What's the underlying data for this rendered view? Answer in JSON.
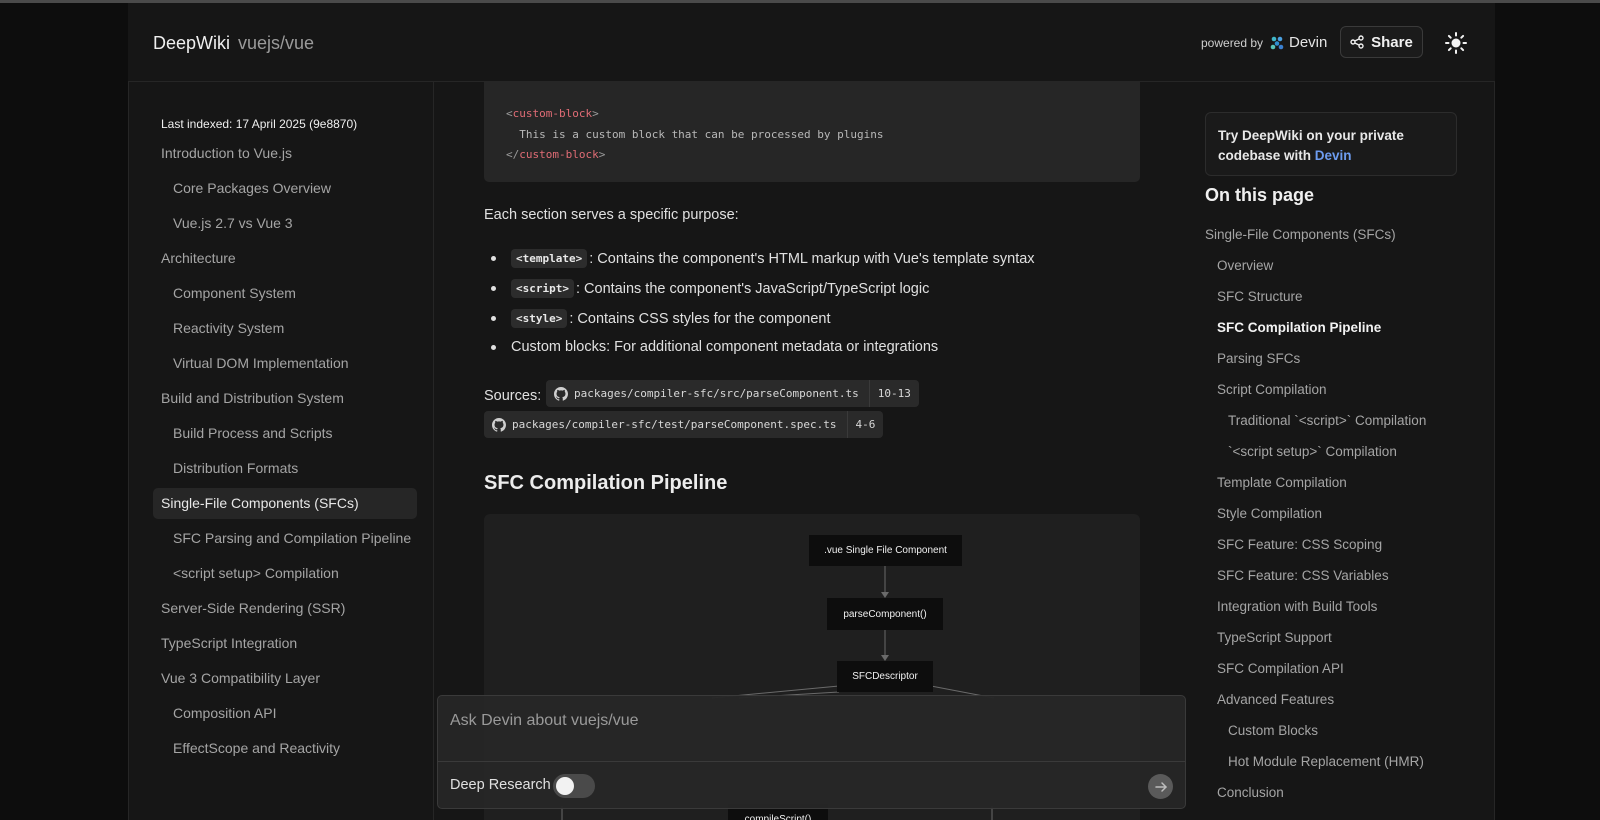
{
  "header": {
    "brand": "DeepWiki",
    "repo": "vuejs/vue",
    "powered_by": "powered by",
    "devin": "Devin",
    "share_label": "Share",
    "theme_icon": "sun-icon"
  },
  "sidebar": {
    "last_indexed": "Last indexed: 17 April 2025 (9e8870)",
    "items": [
      {
        "label": "Introduction to Vue.js",
        "level": 0
      },
      {
        "label": "Core Packages Overview",
        "level": 1
      },
      {
        "label": "Vue.js 2.7 vs Vue 3",
        "level": 1
      },
      {
        "label": "Architecture",
        "level": 0
      },
      {
        "label": "Component System",
        "level": 1
      },
      {
        "label": "Reactivity System",
        "level": 1
      },
      {
        "label": "Virtual DOM Implementation",
        "level": 1
      },
      {
        "label": "Build and Distribution System",
        "level": 0
      },
      {
        "label": "Build Process and Scripts",
        "level": 1
      },
      {
        "label": "Distribution Formats",
        "level": 1
      },
      {
        "label": "Single-File Components (SFCs)",
        "level": 0,
        "active": true
      },
      {
        "label": "SFC Parsing and Compilation Pipeline",
        "level": 1
      },
      {
        "label": "<script setup> Compilation",
        "level": 1
      },
      {
        "label": "Server-Side Rendering (SSR)",
        "level": 0
      },
      {
        "label": "TypeScript Integration",
        "level": 0
      },
      {
        "label": "Vue 3 Compatibility Layer",
        "level": 0
      },
      {
        "label": "Composition API",
        "level": 1
      },
      {
        "label": "EffectScope and Reactivity",
        "level": 1
      }
    ]
  },
  "main": {
    "code": {
      "open_lt": "<",
      "open_tag": "custom-block",
      "open_gt": ">",
      "body": "  This is a custom block that can be processed by plugins",
      "close_lt": "</",
      "close_tag": "custom-block",
      "close_gt": ">"
    },
    "intro": "Each section serves a specific purpose:",
    "bullets": [
      {
        "code": "<template>",
        "text": ": Contains the component's HTML markup with Vue's template syntax"
      },
      {
        "code": "<script>",
        "text": ": Contains the component's JavaScript/TypeScript logic"
      },
      {
        "code": "<style>",
        "text": ": Contains CSS styles for the component"
      },
      {
        "code": "",
        "text": "Custom blocks: For additional component metadata or integrations"
      }
    ],
    "sources_label": "Sources:",
    "sources": [
      {
        "path": "packages/compiler-sfc/src/parseComponent.ts",
        "range": "10-13"
      },
      {
        "path": "packages/compiler-sfc/test/parseComponent.spec.ts",
        "range": "4-6"
      }
    ],
    "section_title": "SFC Compilation Pipeline",
    "diagram": {
      "nodes": [
        ".vue Single File Component",
        "parseComponent()",
        "SFCDescriptor",
        "compileScript()"
      ]
    }
  },
  "right": {
    "promo_text": "Try DeepWiki on your private codebase with ",
    "promo_link": "Devin",
    "on_this_page": "On this page",
    "toc": [
      {
        "label": "Single-File Components (SFCs)",
        "level": 0
      },
      {
        "label": "Overview",
        "level": 1
      },
      {
        "label": "SFC Structure",
        "level": 1
      },
      {
        "label": "SFC Compilation Pipeline",
        "level": 1,
        "current": true
      },
      {
        "label": "Parsing SFCs",
        "level": 1
      },
      {
        "label": "Script Compilation",
        "level": 1
      },
      {
        "label": "Traditional `<script>` Compilation",
        "level": 2
      },
      {
        "label": "`<script setup>` Compilation",
        "level": 2
      },
      {
        "label": "Template Compilation",
        "level": 1
      },
      {
        "label": "Style Compilation",
        "level": 1
      },
      {
        "label": "SFC Feature: CSS Scoping",
        "level": 1
      },
      {
        "label": "SFC Feature: CSS Variables",
        "level": 1
      },
      {
        "label": "Integration with Build Tools",
        "level": 1
      },
      {
        "label": "TypeScript Support",
        "level": 1
      },
      {
        "label": "SFC Compilation API",
        "level": 1
      },
      {
        "label": "Advanced Features",
        "level": 1
      },
      {
        "label": "Custom Blocks",
        "level": 2
      },
      {
        "label": "Hot Module Replacement (HMR)",
        "level": 2
      },
      {
        "label": "Conclusion",
        "level": 1
      }
    ]
  },
  "chat": {
    "placeholder": "Ask Devin about vuejs/vue",
    "deep_research_label": "Deep Research",
    "deep_research_on": false
  },
  "colors": {
    "accent_link": "#6d9cf0",
    "tag": "#e06c75"
  }
}
